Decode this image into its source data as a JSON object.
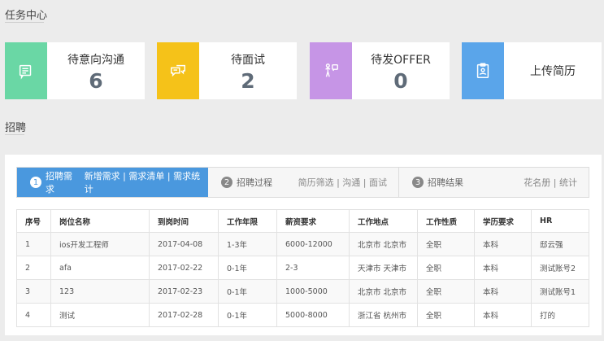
{
  "sections": {
    "tasks": "任务中心",
    "recruit": "招聘"
  },
  "cards": [
    {
      "label": "待意向沟通",
      "value": "6",
      "icon": "chat-doc-icon",
      "color": "#6ad7a5"
    },
    {
      "label": "待面试",
      "value": "2",
      "icon": "speech-bubbles-icon",
      "color": "#f5c219"
    },
    {
      "label": "待发OFFER",
      "value": "0",
      "icon": "offer-person-icon",
      "color": "#c695e6"
    },
    {
      "label": "上传简历",
      "value": "",
      "icon": "clipboard-icon",
      "color": "#5aa5ea"
    }
  ],
  "steps": [
    {
      "num": "1",
      "label": "招聘需求",
      "sub": "新增需求 | 需求清单 | 需求统计"
    },
    {
      "num": "2",
      "label": "招聘过程",
      "sub": "简历筛选 | 沟通 | 面试"
    },
    {
      "num": "3",
      "label": "招聘结果",
      "sub": "花名册 | 统计"
    }
  ],
  "table": {
    "headers": [
      "序号",
      "岗位名称",
      "到岗时间",
      "工作年限",
      "薪资要求",
      "工作地点",
      "工作性质",
      "学历要求",
      "HR"
    ],
    "rows": [
      [
        "1",
        "ios开发工程师",
        "2017-04-08",
        "1-3年",
        "6000-12000",
        "北京市 北京市",
        "全职",
        "本科",
        "邸云强"
      ],
      [
        "2",
        "afa",
        "2017-02-22",
        "0-1年",
        "2-3",
        "天津市 天津市",
        "全职",
        "本科",
        "测试账号2"
      ],
      [
        "3",
        "123",
        "2017-02-23",
        "0-1年",
        "1000-5000",
        "北京市 北京市",
        "全职",
        "本科",
        "测试账号1"
      ],
      [
        "4",
        "测试",
        "2017-02-28",
        "0-1年",
        "5000-8000",
        "浙江省 杭州市",
        "全职",
        "本科",
        "打的"
      ]
    ]
  }
}
